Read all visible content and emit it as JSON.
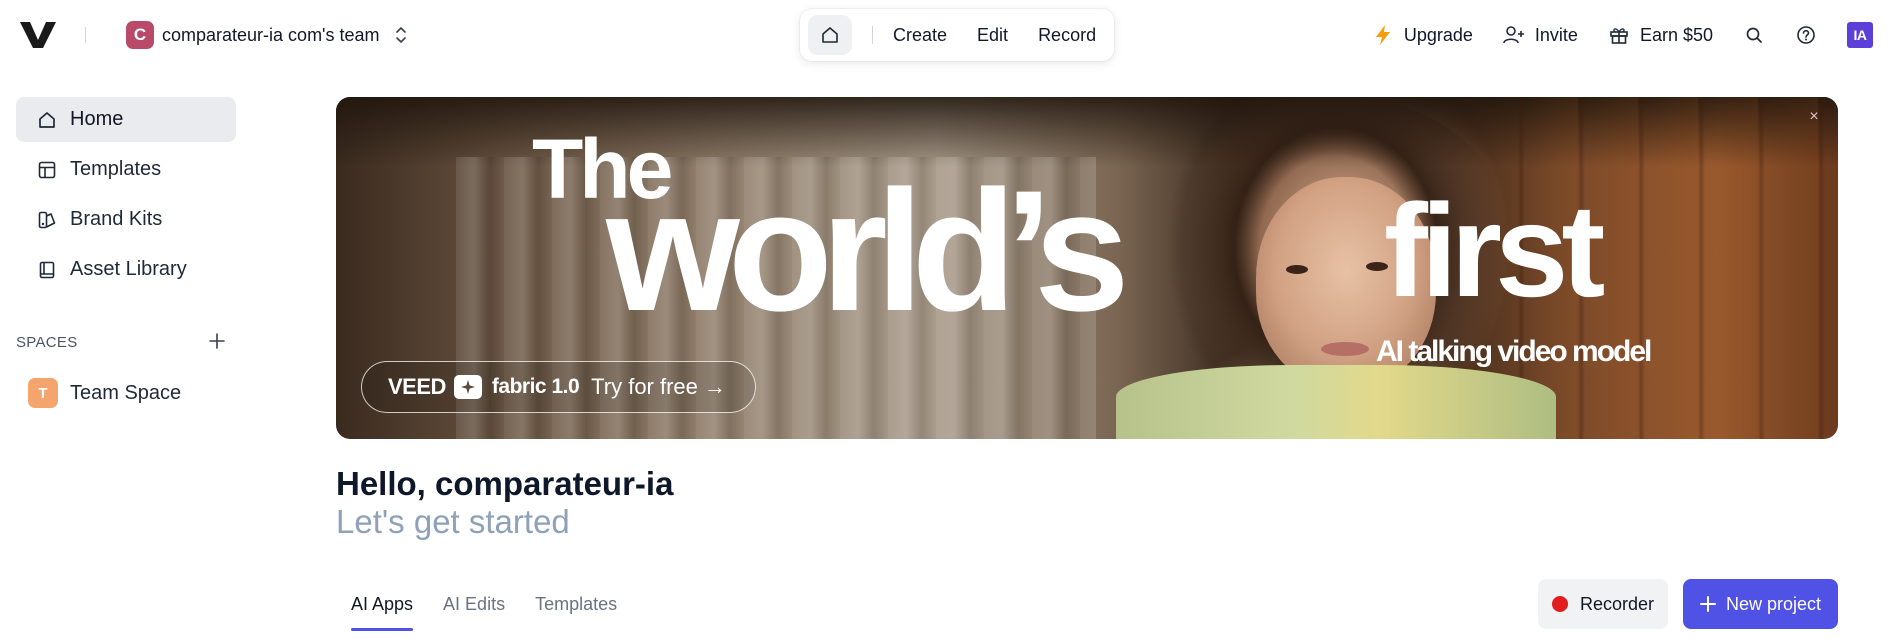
{
  "header": {
    "team": {
      "initial": "C",
      "name": "comparateur-ia com's team"
    },
    "center_nav": [
      "Create",
      "Edit",
      "Record"
    ],
    "right_nav": [
      {
        "label": "Upgrade",
        "icon": "lightning-icon"
      },
      {
        "label": "Invite",
        "icon": "user-plus-icon"
      },
      {
        "label": "Earn $50",
        "icon": "gift-icon"
      }
    ],
    "user_initials": "IA"
  },
  "sidebar": {
    "items": [
      {
        "label": "Home",
        "icon": "home-icon",
        "active": true
      },
      {
        "label": "Templates",
        "icon": "layout-icon"
      },
      {
        "label": "Brand Kits",
        "icon": "brand-kit-icon"
      },
      {
        "label": "Asset Library",
        "icon": "book-icon"
      }
    ],
    "spaces_label": "SPACES",
    "spaces": [
      {
        "initial": "T",
        "name": "Team Space"
      }
    ]
  },
  "banner": {
    "headline_1": "The",
    "headline_2": "world’s",
    "headline_3": "first",
    "subheadline": "AI talking video model",
    "cta": {
      "brand": "VEED",
      "product": "fabric 1.0",
      "action": "Try for free",
      "arrow": "→"
    },
    "close": "×"
  },
  "main": {
    "greeting": "Hello, comparateur-ia",
    "subtitle": "Let's get started",
    "tabs": [
      {
        "label": "AI Apps",
        "active": true
      },
      {
        "label": "AI Edits"
      },
      {
        "label": "Templates"
      }
    ],
    "recorder_label": "Recorder",
    "new_project_label": "New project"
  },
  "colors": {
    "accent": "#4f52e4",
    "team_avatar": "#b94a6a",
    "space_avatar": "#f4a56e",
    "user_badge": "#5b3fd8",
    "record_dot": "#e11d1d",
    "subtitle": "#8ea1b8"
  }
}
